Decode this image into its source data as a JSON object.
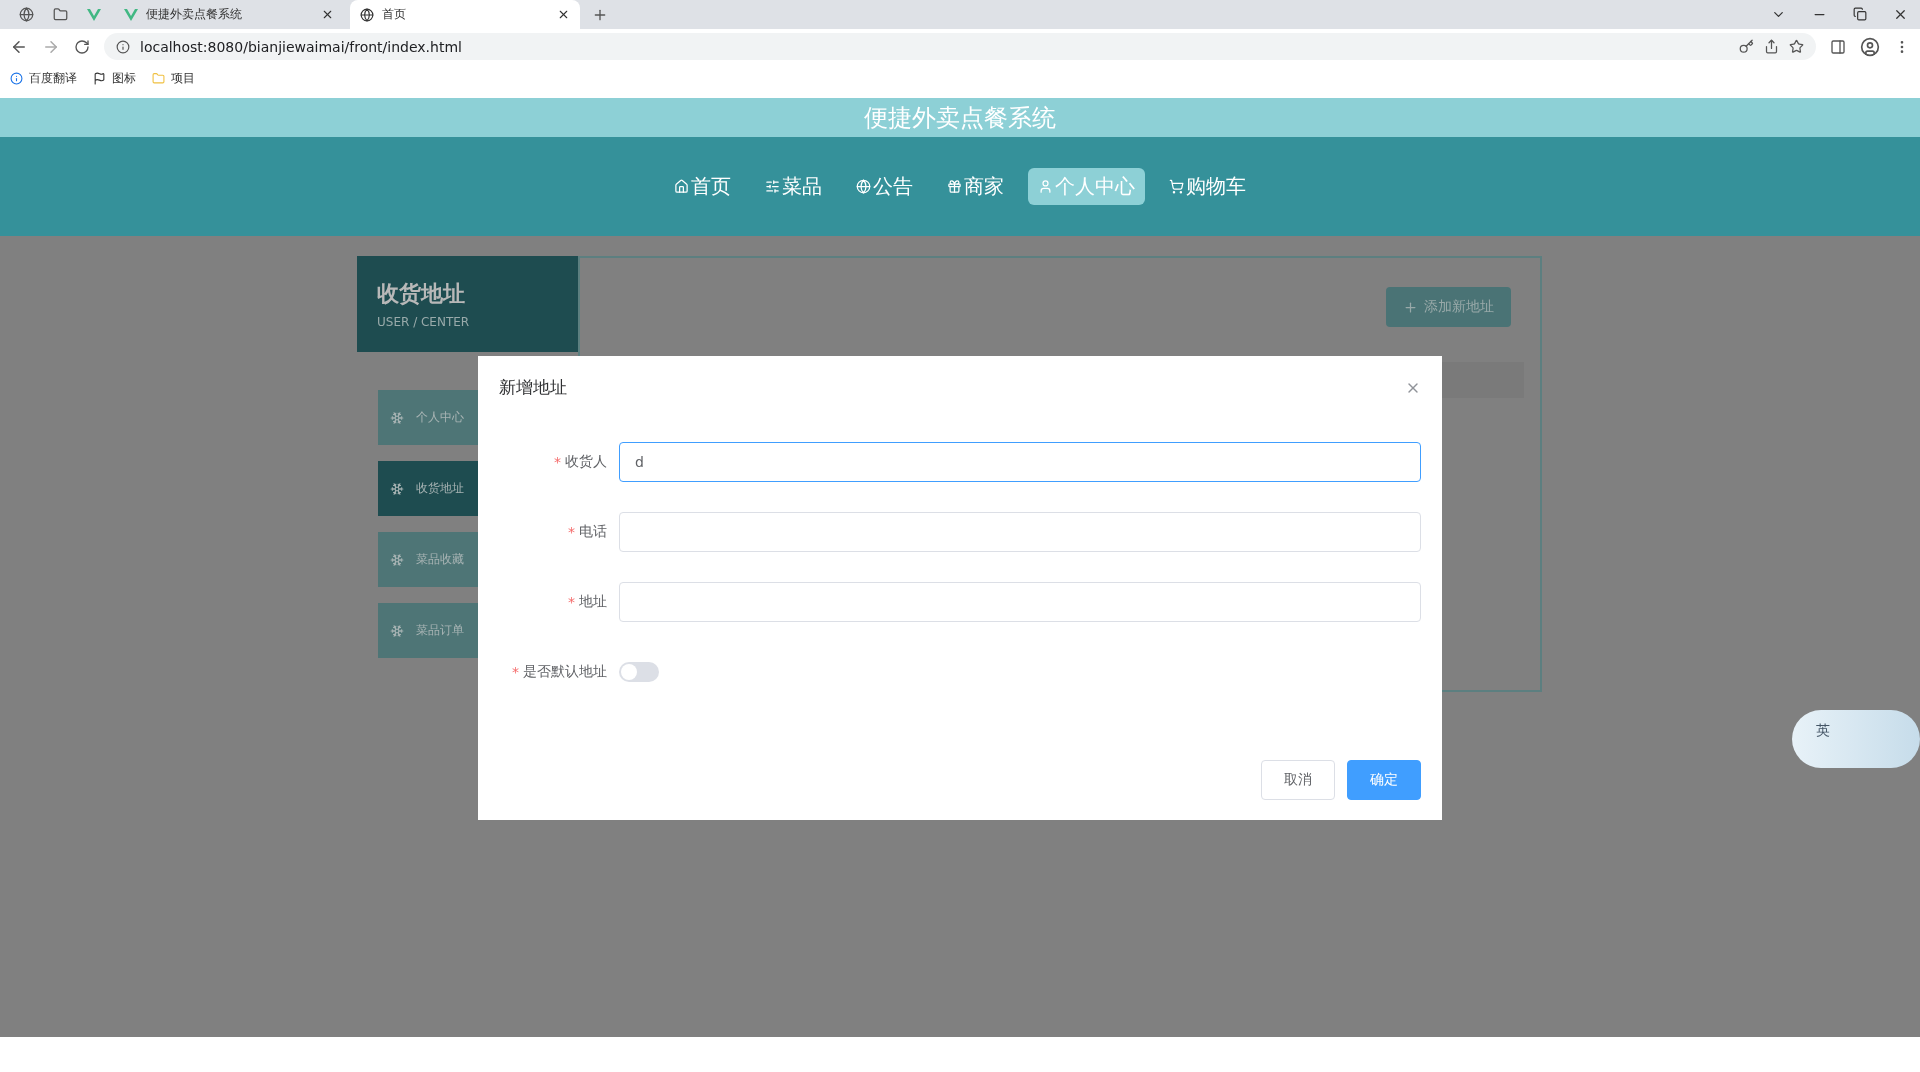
{
  "browser": {
    "tabs": [
      {
        "label": "便捷外卖点餐系统",
        "selected": false
      },
      {
        "label": "首页",
        "selected": true
      }
    ],
    "url": "localhost:8080/bianjiewaimai/front/index.html",
    "bookmarks": [
      "百度翻译",
      "图标",
      "项目"
    ]
  },
  "site_title": "便捷外卖点餐系统",
  "nav": [
    {
      "label": "首页",
      "selected": false
    },
    {
      "label": "菜品",
      "selected": false
    },
    {
      "label": "公告",
      "selected": false
    },
    {
      "label": "商家",
      "selected": false
    },
    {
      "label": "个人中心",
      "selected": true
    },
    {
      "label": "购物车",
      "selected": false
    }
  ],
  "sidebar": {
    "title": "收货地址",
    "subtitle": "USER / CENTER",
    "items": [
      {
        "label": "个人中心",
        "selected": false
      },
      {
        "label": "收货地址",
        "selected": true
      },
      {
        "label": "菜品收藏",
        "selected": false
      },
      {
        "label": "菜品订单",
        "selected": false
      }
    ]
  },
  "add_button": "添加新地址",
  "dialog": {
    "title": "新增地址",
    "fields": [
      {
        "kind": "text",
        "mark": "*",
        "label": "收货人",
        "value": "d",
        "focused": true
      },
      {
        "kind": "text",
        "mark": "*",
        "label": "电话",
        "focused": false
      },
      {
        "kind": "text",
        "mark": "*",
        "label": "地址",
        "focused": false
      },
      {
        "kind": "switch",
        "mark": "*",
        "label": "是否默认地址",
        "on": false
      }
    ],
    "buttons": [
      {
        "label": "取消",
        "primary": false
      },
      {
        "label": "确定",
        "primary": true
      }
    ]
  },
  "ime_widget": {
    "label": "英"
  }
}
